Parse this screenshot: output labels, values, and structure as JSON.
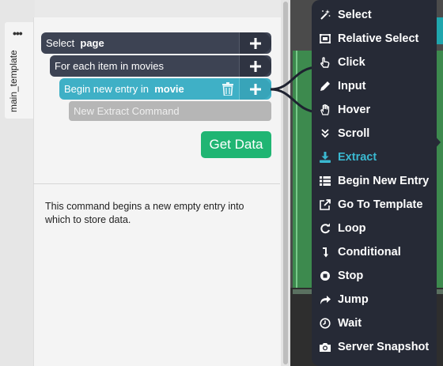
{
  "sidebar": {
    "template_tab_label": "main_template"
  },
  "commands": [
    {
      "prefix": "Select",
      "bold": "page"
    },
    {
      "prefix": "For each item in movies",
      "bold": ""
    },
    {
      "prefix": "Begin new entry in",
      "bold": "movie"
    },
    {
      "placeholder": "New Extract Command"
    }
  ],
  "actions": {
    "get_data_label": "Get Data"
  },
  "description": "This command begins a new empty entry into which to store data.",
  "menu": {
    "items": [
      {
        "label": "Select",
        "icon": "magic-wand-icon"
      },
      {
        "label": "Relative Select",
        "icon": "relative-select-icon"
      },
      {
        "label": "Click",
        "icon": "pointer-hand-icon"
      },
      {
        "label": "Input",
        "icon": "pencil-icon"
      },
      {
        "label": "Hover",
        "icon": "hover-hand-icon"
      },
      {
        "label": "Scroll",
        "icon": "double-chevron-down-icon"
      },
      {
        "label": "Extract",
        "icon": "download-icon",
        "active": true
      },
      {
        "label": "Begin New Entry",
        "icon": "list-icon"
      },
      {
        "label": "Go To Template",
        "icon": "external-link-icon"
      },
      {
        "label": "Loop",
        "icon": "loop-icon"
      },
      {
        "label": "Conditional",
        "icon": "conditional-arrow-icon"
      },
      {
        "label": "Stop",
        "icon": "stop-circle-icon"
      },
      {
        "label": "Jump",
        "icon": "share-arrow-icon"
      },
      {
        "label": "Wait",
        "icon": "clock-icon"
      },
      {
        "label": "Server Snapshot",
        "icon": "camera-icon"
      }
    ]
  },
  "colors": {
    "command_dark": "#3d4353",
    "command_selected": "#3fb0c6",
    "get_data": "#20b573",
    "menu_bg": "#262a36",
    "menu_active": "#3ab8d0"
  }
}
